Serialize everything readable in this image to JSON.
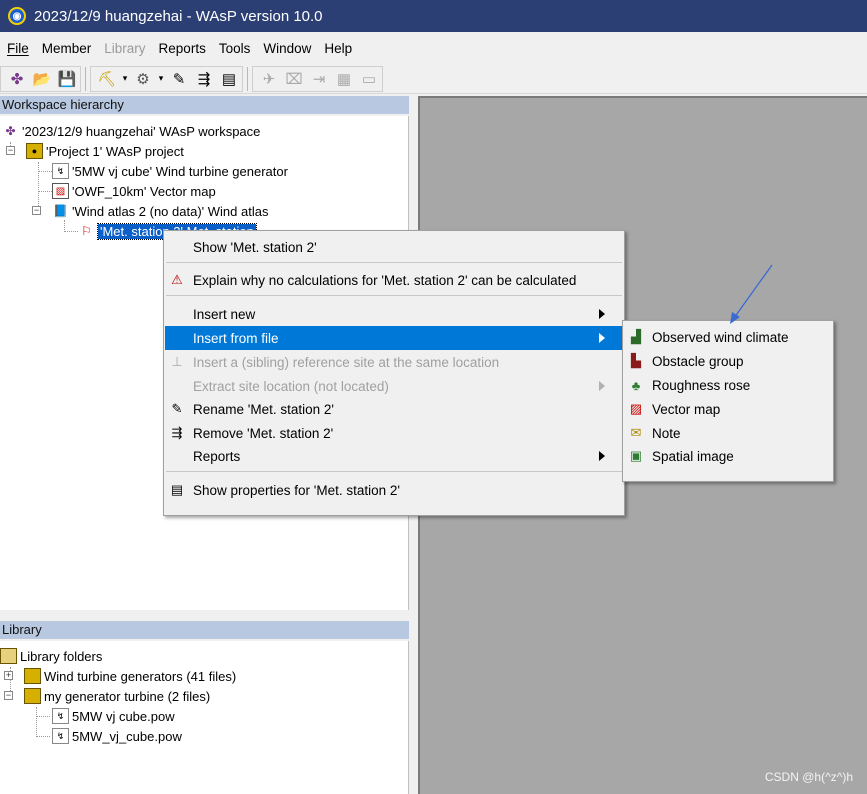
{
  "window": {
    "title": "2023/12/9 huangzehai - WAsP version 10.0"
  },
  "menubar": [
    "File",
    "Member",
    "Library",
    "Reports",
    "Tools",
    "Window",
    "Help"
  ],
  "workspace": {
    "header": "Workspace hierarchy",
    "root": "'2023/12/9 huangzehai' WAsP workspace",
    "project": "'Project 1' WAsP project",
    "turbine": "'5MW vj cube' Wind turbine generator",
    "vector_map": "'OWF_10km' Vector map",
    "wind_atlas": "'Wind atlas 2 (no data)' Wind atlas",
    "met_station": "'Met. station 2' Met. station"
  },
  "library": {
    "header": "Library",
    "root": "Library folders",
    "folder1": "Wind turbine generators (41 files)",
    "folder2": "my generator turbine (2 files)",
    "file1": "5MW vj cube.pow",
    "file2": "5MW_vj_cube.pow"
  },
  "context_menu": {
    "show": "Show 'Met. station 2'",
    "explain": "Explain why no calculations for 'Met. station 2' can be calculated",
    "insert_new": "Insert new",
    "insert_from_file": "Insert from file",
    "insert_sibling": "Insert a (sibling) reference site at the same location",
    "extract": "Extract site location (not located)",
    "rename": "Rename 'Met. station 2'",
    "remove": "Remove 'Met. station 2'",
    "reports": "Reports",
    "properties": "Show properties for 'Met. station 2'"
  },
  "submenu": {
    "observed": "Observed wind climate",
    "obstacle": "Obstacle group",
    "roughness": "Roughness rose",
    "vector_map": "Vector map",
    "note": "Note",
    "spatial": "Spatial image"
  },
  "watermark": "CSDN @h(^z^)h",
  "colors": {
    "titlebar": "#2c3f74",
    "highlight": "#0078d7",
    "panel_header": "#b8c8e0",
    "mdi_background": "#a7a7a7"
  }
}
